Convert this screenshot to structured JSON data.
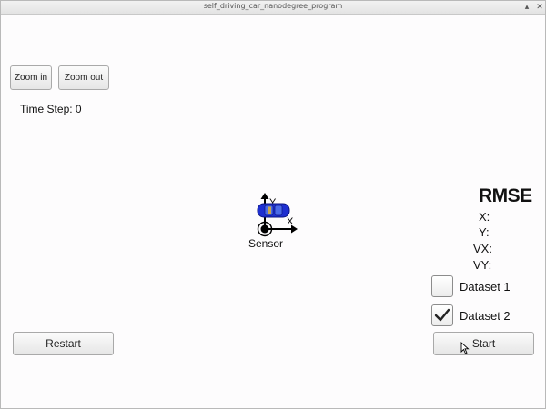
{
  "window": {
    "title": "self_driving_car_nanodegree_program"
  },
  "toolbar": {
    "zoom_in": "Zoom in",
    "zoom_out": "Zoom out"
  },
  "status": {
    "time_step_label": "Time Step:",
    "time_step_value": "0"
  },
  "scene": {
    "sensor_label": "Sensor",
    "axis_x": "X",
    "axis_y": "Y",
    "car_color": "#1e2fd0"
  },
  "rmse": {
    "title": "RMSE",
    "x": "X:",
    "y": "Y:",
    "vx": "VX:",
    "vy": "VY:"
  },
  "datasets": [
    {
      "label": "Dataset 1",
      "checked": false
    },
    {
      "label": "Dataset 2",
      "checked": true
    }
  ],
  "controls": {
    "restart": "Restart",
    "start": "Start"
  }
}
